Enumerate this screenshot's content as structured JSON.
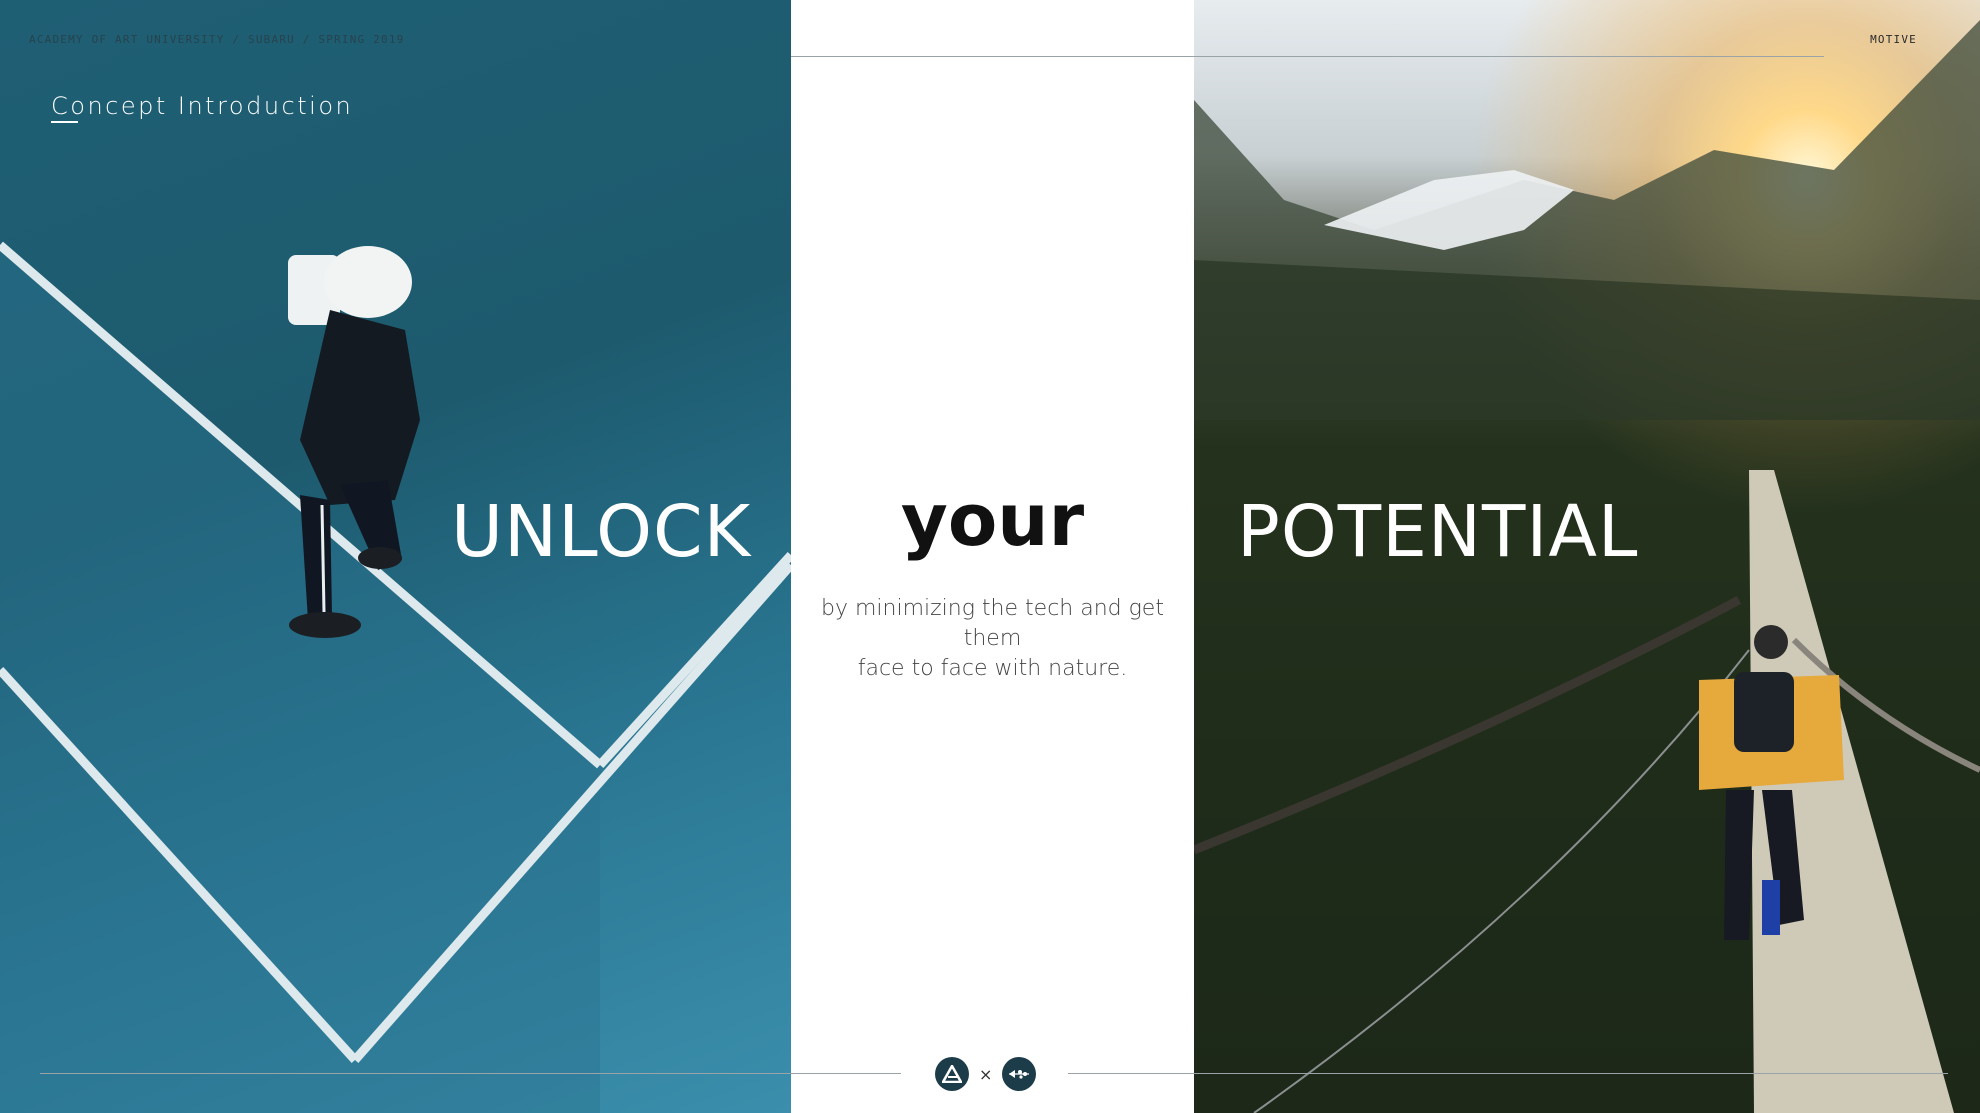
{
  "header": {
    "left_text": "ACADEMY OF ART UNIVERSITY / SUBARU / SPRING 2019",
    "right_text": "MOTIVE"
  },
  "section_title": "Concept Introduction",
  "headline": {
    "word_left": "UNLOCK",
    "word_middle": "your",
    "word_right": "POTENTIAL"
  },
  "subtitle": {
    "line1": "by minimizing the tech and get them",
    "line2": "face to face with nature."
  },
  "logos": {
    "separator": "×",
    "left_logo_icon": "academy-of-art-logo-icon",
    "right_logo_icon": "subaru-logo-icon"
  },
  "colors": {
    "court_blue": "#1f5f74",
    "headline_white": "#ffffff",
    "your_black": "#111111",
    "logo_navy": "#1d3c4a"
  }
}
